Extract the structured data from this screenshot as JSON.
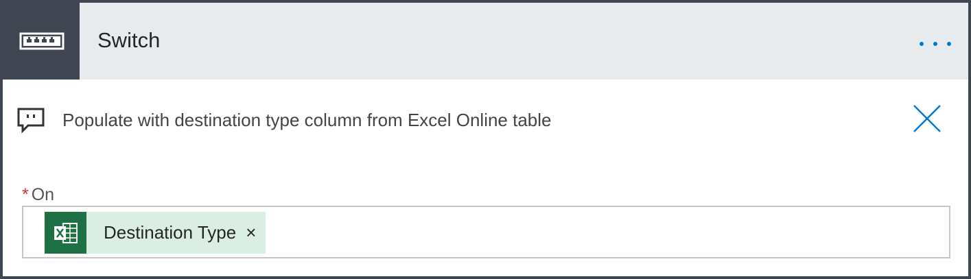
{
  "header": {
    "title": "Switch",
    "action_icon": "switch-icon",
    "more_icon": "more-options-icon",
    "colors": {
      "header_bg": "#e8ebee",
      "icon_bg": "#3f4652",
      "accent": "#0078d4"
    }
  },
  "comment": {
    "icon": "comment-icon",
    "text": "Populate with destination type column from Excel Online table",
    "close_icon": "close-icon"
  },
  "field": {
    "required_marker": "*",
    "label": "On",
    "token": {
      "icon": "excel-icon",
      "label": "Destination Type",
      "remove_symbol": "×",
      "colors": {
        "token_bg": "#dbeee4",
        "icon_bg": "#1e7145"
      }
    }
  }
}
